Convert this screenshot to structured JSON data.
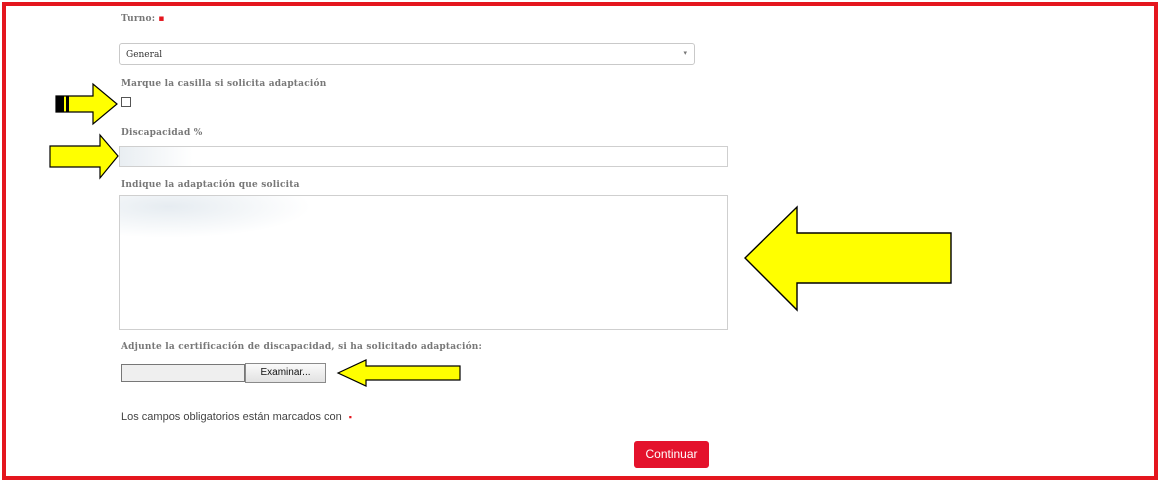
{
  "form": {
    "turno_label": "Turno:",
    "required_mark": "▪",
    "turno_value": "General",
    "caret": "▾",
    "adaptacion_checkbox_label": "Marque la casilla si solicita adaptación",
    "discapacidad_label": "Discapacidad %",
    "discapacidad_value": "",
    "adaptacion_text_label": "Indique la adaptación que solicita",
    "adaptacion_text_value": "",
    "certificacion_label": "Adjunte la certificación de discapacidad, si ha solicitado adaptación:",
    "browse_label": "Examinar...",
    "required_note": "Los campos obligatorios están marcados con",
    "continue_label": "Continuar"
  },
  "colors": {
    "frame_border": "#e4161e",
    "accent_button": "#e4122c",
    "arrow_fill": "#ffff00"
  }
}
